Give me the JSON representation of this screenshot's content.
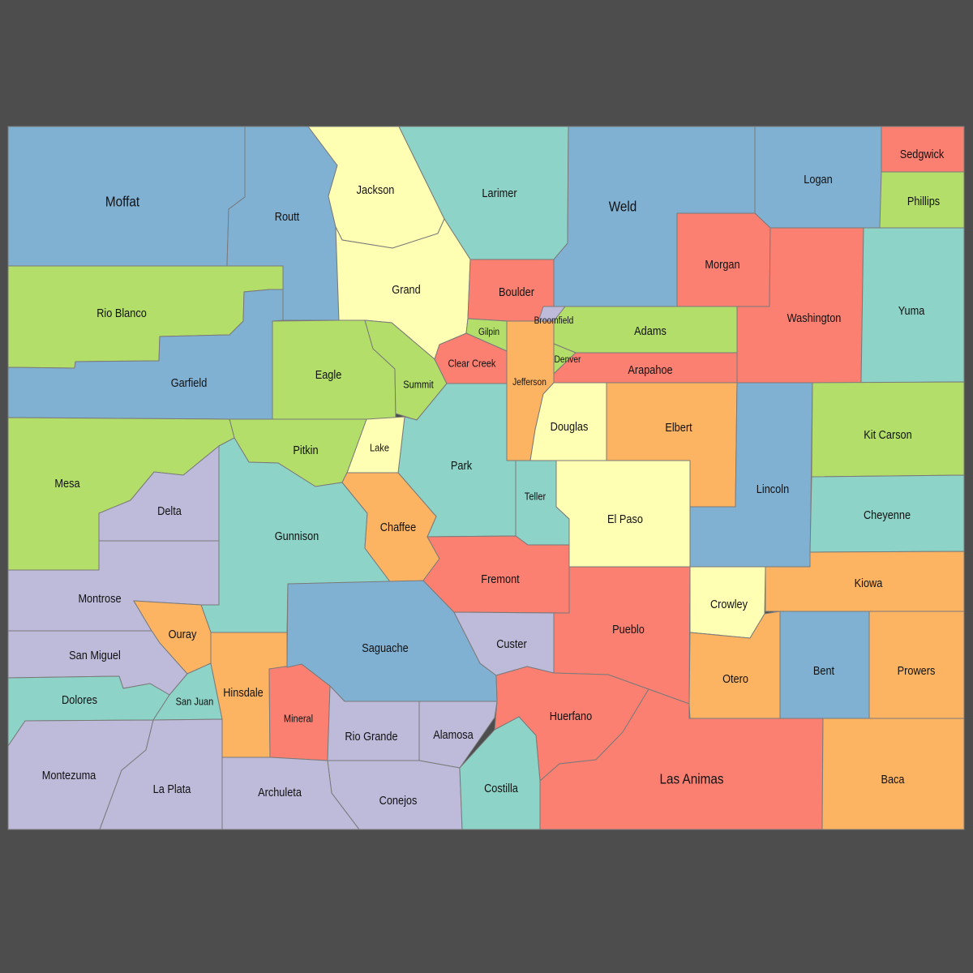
{
  "map": {
    "colors": {
      "blue": "#80b1d3",
      "green": "#b3de69",
      "teal": "#8dd3c7",
      "yellow": "#ffffb3",
      "salmon": "#fb8072",
      "orange": "#fdb462",
      "lavender": "#bebada",
      "background": "#4d4d4d"
    },
    "counties": [
      {
        "name": "Moffat",
        "color": "blue"
      },
      {
        "name": "Routt",
        "color": "blue"
      },
      {
        "name": "Jackson",
        "color": "yellow"
      },
      {
        "name": "Larimer",
        "color": "teal"
      },
      {
        "name": "Weld",
        "color": "blue"
      },
      {
        "name": "Logan",
        "color": "blue"
      },
      {
        "name": "Sedgwick",
        "color": "salmon"
      },
      {
        "name": "Phillips",
        "color": "green"
      },
      {
        "name": "Morgan",
        "color": "salmon"
      },
      {
        "name": "Washington",
        "color": "salmon"
      },
      {
        "name": "Yuma",
        "color": "teal"
      },
      {
        "name": "Rio Blanco",
        "color": "green"
      },
      {
        "name": "Garfield",
        "color": "blue"
      },
      {
        "name": "Grand",
        "color": "yellow"
      },
      {
        "name": "Eagle",
        "color": "green"
      },
      {
        "name": "Summit",
        "color": "green"
      },
      {
        "name": "Boulder",
        "color": "salmon"
      },
      {
        "name": "Broomfield",
        "color": "lavender"
      },
      {
        "name": "Gilpin",
        "color": "green"
      },
      {
        "name": "Clear Creek",
        "color": "salmon"
      },
      {
        "name": "Jefferson",
        "color": "orange"
      },
      {
        "name": "Adams",
        "color": "green"
      },
      {
        "name": "Denver",
        "color": "green"
      },
      {
        "name": "Arapahoe",
        "color": "salmon"
      },
      {
        "name": "Douglas",
        "color": "yellow"
      },
      {
        "name": "Elbert",
        "color": "orange"
      },
      {
        "name": "Lincoln",
        "color": "blue"
      },
      {
        "name": "Kit Carson",
        "color": "green"
      },
      {
        "name": "Cheyenne",
        "color": "teal"
      },
      {
        "name": "Kiowa",
        "color": "orange"
      },
      {
        "name": "Park",
        "color": "teal"
      },
      {
        "name": "Lake",
        "color": "yellow"
      },
      {
        "name": "Teller",
        "color": "teal"
      },
      {
        "name": "El Paso",
        "color": "yellow"
      },
      {
        "name": "Pitkin",
        "color": "green"
      },
      {
        "name": "Mesa",
        "color": "green"
      },
      {
        "name": "Delta",
        "color": "lavender"
      },
      {
        "name": "Gunnison",
        "color": "teal"
      },
      {
        "name": "Chaffee",
        "color": "orange"
      },
      {
        "name": "Montrose",
        "color": "lavender"
      },
      {
        "name": "Ouray",
        "color": "orange"
      },
      {
        "name": "San Miguel",
        "color": "lavender"
      },
      {
        "name": "Dolores",
        "color": "teal"
      },
      {
        "name": "San Juan",
        "color": "teal"
      },
      {
        "name": "Montezuma",
        "color": "lavender"
      },
      {
        "name": "La Plata",
        "color": "lavender"
      },
      {
        "name": "Hinsdale",
        "color": "orange"
      },
      {
        "name": "Mineral",
        "color": "salmon"
      },
      {
        "name": "Saguache",
        "color": "blue"
      },
      {
        "name": "Fremont",
        "color": "salmon"
      },
      {
        "name": "Custer",
        "color": "lavender"
      },
      {
        "name": "Pueblo",
        "color": "salmon"
      },
      {
        "name": "Crowley",
        "color": "yellow"
      },
      {
        "name": "Otero",
        "color": "orange"
      },
      {
        "name": "Bent",
        "color": "blue"
      },
      {
        "name": "Prowers",
        "color": "orange"
      },
      {
        "name": "Rio Grande",
        "color": "lavender"
      },
      {
        "name": "Alamosa",
        "color": "lavender"
      },
      {
        "name": "Conejos",
        "color": "lavender"
      },
      {
        "name": "Archuleta",
        "color": "lavender"
      },
      {
        "name": "Huerfano",
        "color": "salmon"
      },
      {
        "name": "Costilla",
        "color": "teal"
      },
      {
        "name": "Las Animas",
        "color": "salmon"
      },
      {
        "name": "Baca",
        "color": "orange"
      }
    ]
  }
}
